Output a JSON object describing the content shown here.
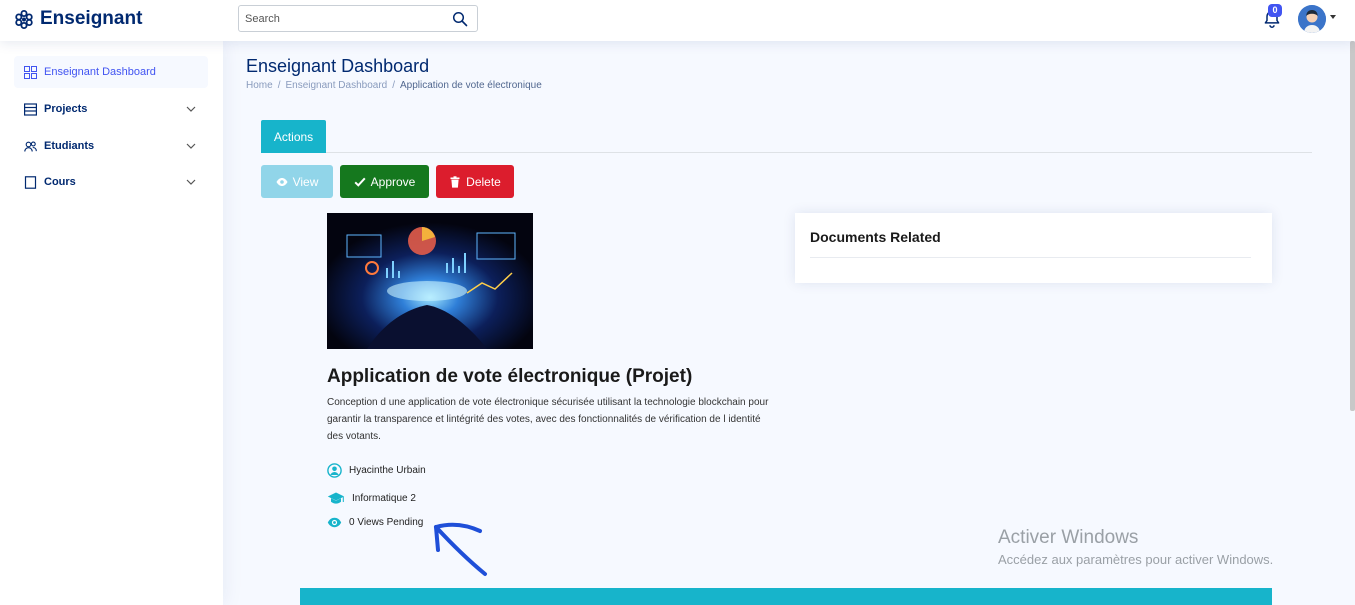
{
  "header": {
    "brand": "Enseignant",
    "search_placeholder": "Search",
    "notification_count": "0"
  },
  "sidebar": {
    "items": [
      {
        "label": "Enseignant Dashboard",
        "icon": "grid-icon",
        "active": true
      },
      {
        "label": "Projects",
        "icon": "layout-icon"
      },
      {
        "label": "Etudiants",
        "icon": "people-icon"
      },
      {
        "label": "Cours",
        "icon": "book-icon"
      }
    ]
  },
  "page": {
    "title": "Enseignant Dashboard",
    "breadcrumb": [
      "Home",
      "Enseignant Dashboard",
      "Application de vote électronique"
    ]
  },
  "tabs": {
    "actions": "Actions"
  },
  "buttons": {
    "view": "View",
    "approve": "Approve",
    "delete": "Delete"
  },
  "project": {
    "title": "Application de vote électronique (Projet)",
    "description": "Conception d une application de vote électronique sécurisée utilisant la technologie blockchain pour garantir la transparence et lintégrité des votes, avec des fonctionnalités de vérification de l identité des votants.",
    "author": "Hyacinthe Urbain",
    "class": "Informatique 2",
    "views": "0 Views Pending"
  },
  "documents": {
    "title": "Documents Related"
  },
  "watermark": {
    "line1": "Activer Windows",
    "line2": "Accédez aux paramètres pour activer Windows."
  },
  "colors": {
    "brand": "#012970",
    "accent": "#17b4cb",
    "approve": "#15781e",
    "delete": "#dc1d2d",
    "view": "#91d5e9"
  }
}
